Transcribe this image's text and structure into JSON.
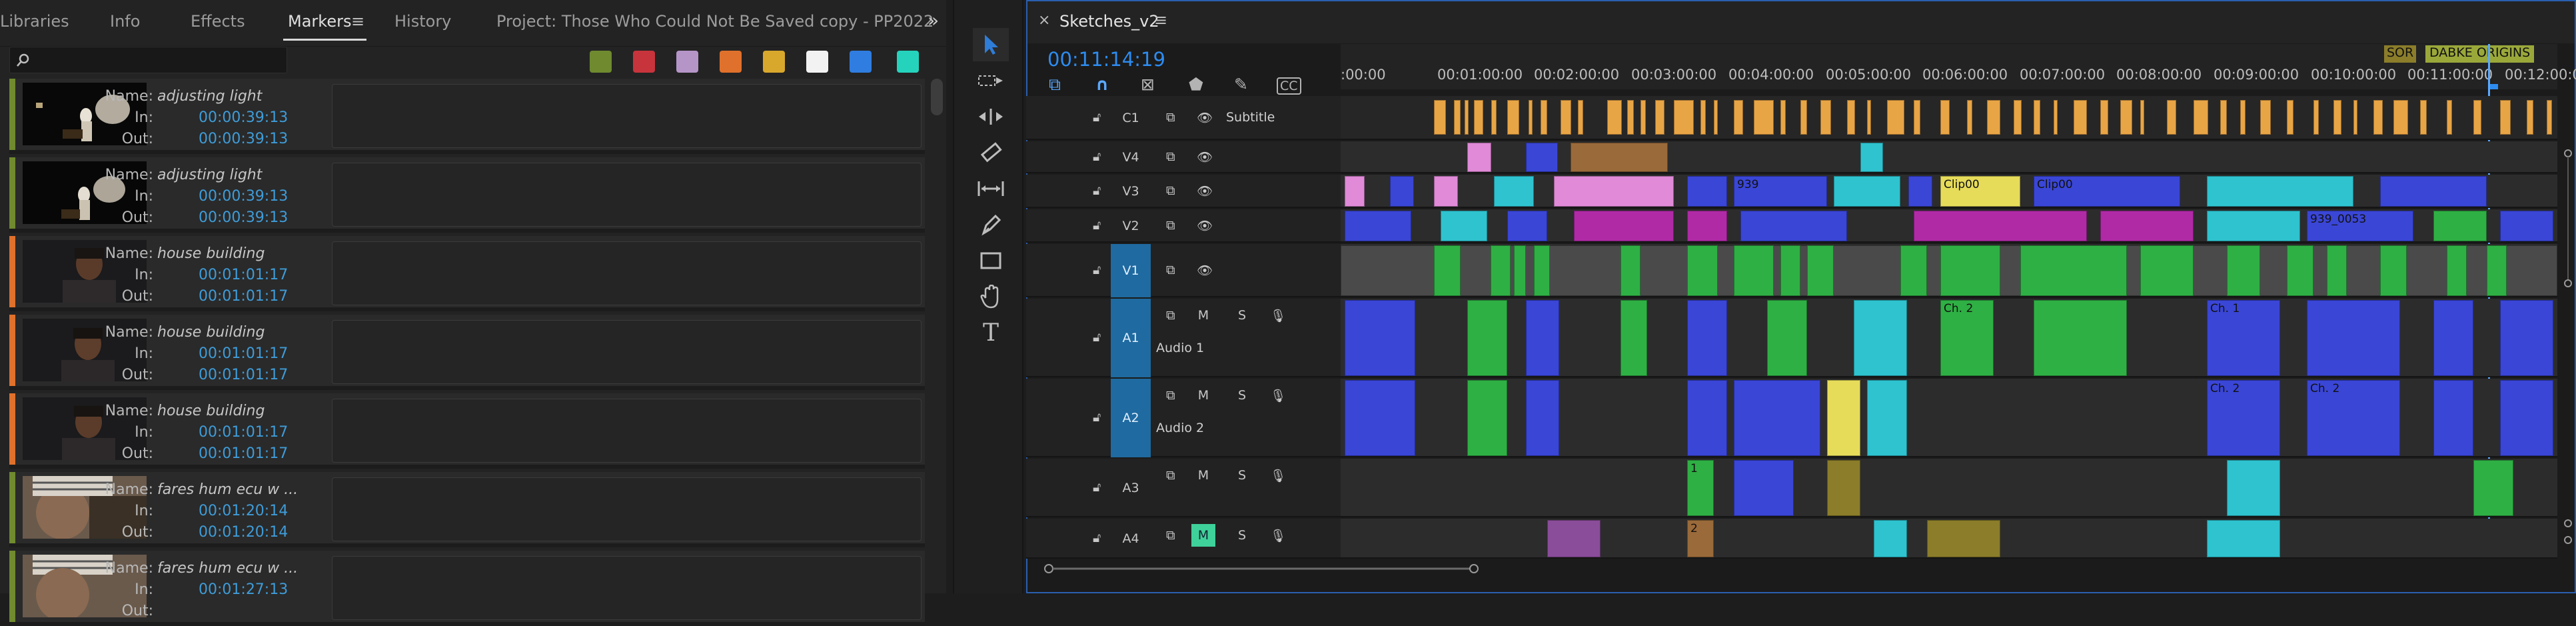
{
  "left_panel": {
    "tabs": [
      "Libraries",
      "Info",
      "Effects",
      "Markers",
      "History"
    ],
    "active_tab": "Markers",
    "project_title": "Project: Those Who Could Not Be Saved  copy - PP2022",
    "search_placeholder": "",
    "swatch_colors": [
      "#6f8a2f",
      "#c8343c",
      "#b595c8",
      "#e0712c",
      "#d8a82c",
      "#f2f2f2",
      "#2f7de0",
      "#25d3bd"
    ],
    "labels": {
      "name": "Name:",
      "in": "In:",
      "out": "Out:"
    },
    "markers": [
      {
        "name": "adjusting light",
        "in": "00:00:39:13",
        "out": "00:00:39:13",
        "color": "#6f8a2f"
      },
      {
        "name": "adjusting light",
        "in": "00:00:39:13",
        "out": "00:00:39:13",
        "color": "#6f8a2f"
      },
      {
        "name": "house building",
        "in": "00:01:01:17",
        "out": "00:01:01:17",
        "color": "#e0712c"
      },
      {
        "name": "house building",
        "in": "00:01:01:17",
        "out": "00:01:01:17",
        "color": "#e0712c"
      },
      {
        "name": "house building",
        "in": "00:01:01:17",
        "out": "00:01:01:17",
        "color": "#e0712c"
      },
      {
        "name": "fares hum ecu w ...",
        "in": "00:01:20:14",
        "out": "00:01:20:14",
        "color": "#6f8a2f"
      },
      {
        "name": "fares hum ecu w ...",
        "in": "00:01:27:13",
        "out": "",
        "color": "#6f8a2f"
      }
    ]
  },
  "tools": [
    "selection-tool",
    "track-select-tool",
    "ripple-edit-tool",
    "razor-tool",
    "slip-tool",
    "pen-tool",
    "rectangle-tool",
    "hand-tool",
    "type-tool"
  ],
  "timeline": {
    "sequence_name": "Sketches_v2",
    "timecode": "00:11:14:19",
    "ruler_ticks": [
      ":00:00",
      "00:01:00:00",
      "00:02:00:00",
      "00:03:00:00",
      "00:04:00:00",
      "00:05:00:00",
      "00:06:00:00",
      "00:07:00:00",
      "00:08:00:00",
      "00:09:00:00",
      "00:10:00:00",
      "00:11:00:00",
      "00:12:00:00"
    ],
    "ruler_markers": [
      "SOR",
      "DABKE ORIGINS"
    ],
    "tracks": [
      {
        "id": "C1",
        "name": "Subtitle"
      },
      {
        "id": "V4",
        "name": ""
      },
      {
        "id": "V3",
        "name": ""
      },
      {
        "id": "V2",
        "name": ""
      },
      {
        "id": "V1",
        "name": ""
      },
      {
        "id": "A1",
        "name": "Audio 1"
      },
      {
        "id": "A2",
        "name": "Audio 2"
      },
      {
        "id": "A3",
        "name": ""
      },
      {
        "id": "A4",
        "name": ""
      }
    ],
    "track_buttons": {
      "mute": "M",
      "solo": "S"
    },
    "clip_labels": [
      "939",
      "Clip00",
      "Clip00",
      "939_0053",
      "Ch. 2",
      "Ch. 1",
      "Ch. 2",
      "Ch. 2",
      "1",
      "2",
      "2"
    ],
    "colors": {
      "subtitle": "#e8a546",
      "pink": "#e08ad8",
      "blue": "#3a46d6",
      "green": "#2fb044",
      "cyan": "#2ec3cf",
      "magenta": "#b02aa6",
      "yellow": "#e6dc5a",
      "brown": "#9a6a3a",
      "olive": "#8b7d2a",
      "accent": "#2d8cf0"
    }
  }
}
